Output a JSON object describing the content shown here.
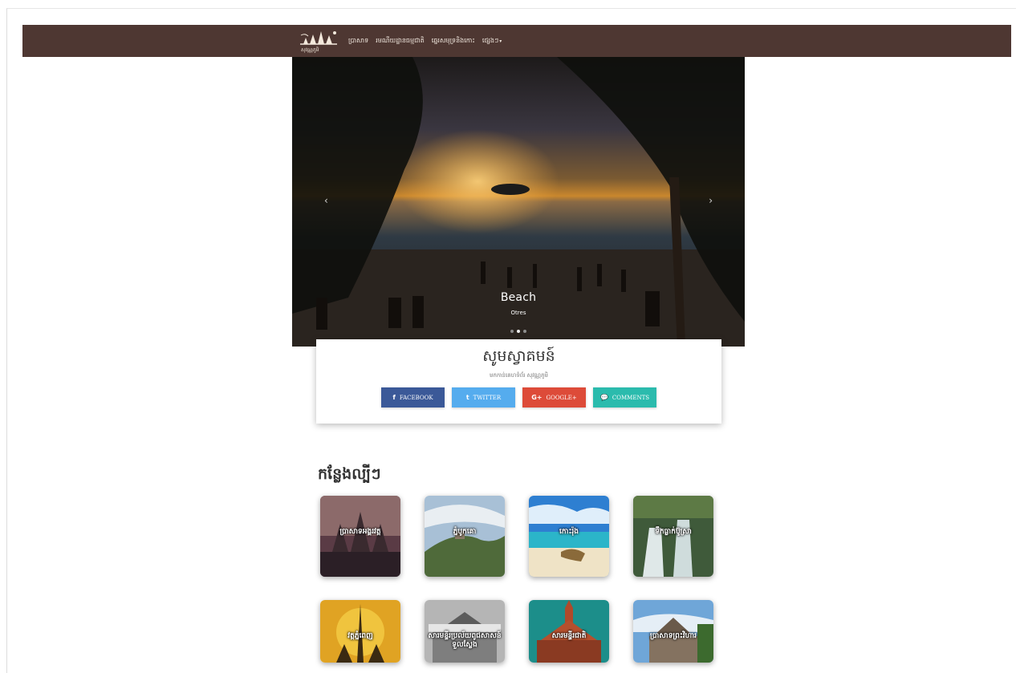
{
  "navbar": {
    "logo_text": "សុវណ្ណភូមិ",
    "links": [
      {
        "label": "ប្រាសាទ"
      },
      {
        "label": "រមណីយដ្ឋានធម្មជាតិ"
      },
      {
        "label": "ឆ្នេរសមុទ្រនិងកោះ"
      },
      {
        "label": "ផ្សេងៗ"
      }
    ],
    "dropdown_caret": "▾"
  },
  "hero": {
    "title": "Beach",
    "subtitle": "Otres",
    "prev_icon": "‹",
    "next_icon": "›",
    "slides_count": 3,
    "active_slide": 2
  },
  "welcome": {
    "title": "សូមស្វាគមន៍",
    "subtitle": "មកកាន់គេហទំព័រ សុវណ្ណភូមិ",
    "buttons": [
      {
        "label": "FACEBOOK",
        "icon": "f",
        "color": "#3b5998"
      },
      {
        "label": "TWITTER",
        "icon": "t",
        "color": "#55acee"
      },
      {
        "label": "GOOGLE+",
        "icon": "G+",
        "color": "#dd4b39"
      },
      {
        "label": "COMMENTS",
        "icon": "💬",
        "color": "#2bbbad"
      }
    ]
  },
  "places": {
    "title": "កន្លែងល្បីៗ",
    "items": [
      {
        "label": "ប្រាសាទអង្គរវត្ត"
      },
      {
        "label": "ភ្នំបូកគោ"
      },
      {
        "label": "កោះរ៉ុង"
      },
      {
        "label": "ទឹកធ្លាក់ប៊ូស្រា"
      },
      {
        "label": "វត្តភ្នំពេញ"
      },
      {
        "label": "សារមន្ទីរប្រល័យពូជសាសន៍ទួលស្លែង"
      },
      {
        "label": "សារមន្ទីរជាតិ"
      },
      {
        "label": "ប្រាសាទព្រះវិហារ"
      }
    ]
  }
}
